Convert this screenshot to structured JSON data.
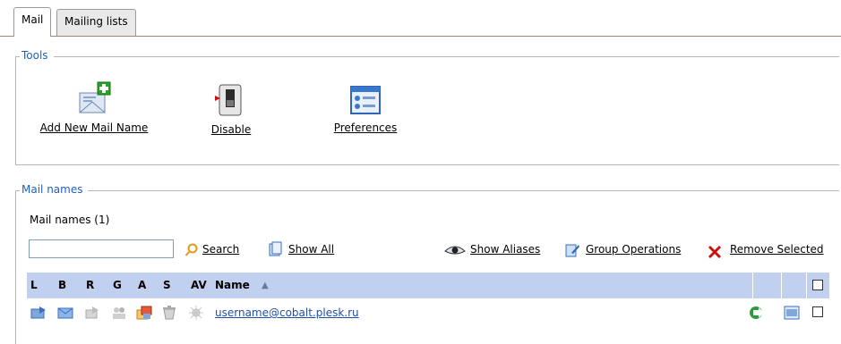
{
  "tabs": [
    {
      "label": "Mail",
      "active": true
    },
    {
      "label": "Mailing lists",
      "active": false
    }
  ],
  "tools": {
    "legend": "Tools",
    "items": [
      {
        "label": "Add New Mail Name",
        "icon": "add-mail-name-icon"
      },
      {
        "label": "Disable",
        "icon": "disable-switch-icon"
      },
      {
        "label": "Preferences",
        "icon": "preferences-icon"
      }
    ]
  },
  "mailnames": {
    "legend": "Mail names",
    "count_label": "Mail names (1)",
    "search": {
      "value": "",
      "button_label": "Search"
    },
    "show_all_label": "Show All",
    "show_aliases_label": "Show Aliases",
    "group_operations_label": "Group Operations",
    "remove_selected_label": "Remove Selected",
    "columns": [
      "L",
      "B",
      "R",
      "G",
      "A",
      "S",
      "AV",
      "Name"
    ],
    "sort_indicator": "▲",
    "rows": [
      {
        "name": "username@cobalt.plesk.ru",
        "checked": false
      }
    ]
  },
  "colors": {
    "accent_blue": "#1f5fbf",
    "header_bg": "#c2d0ef",
    "remove_red": "#cc1111"
  }
}
